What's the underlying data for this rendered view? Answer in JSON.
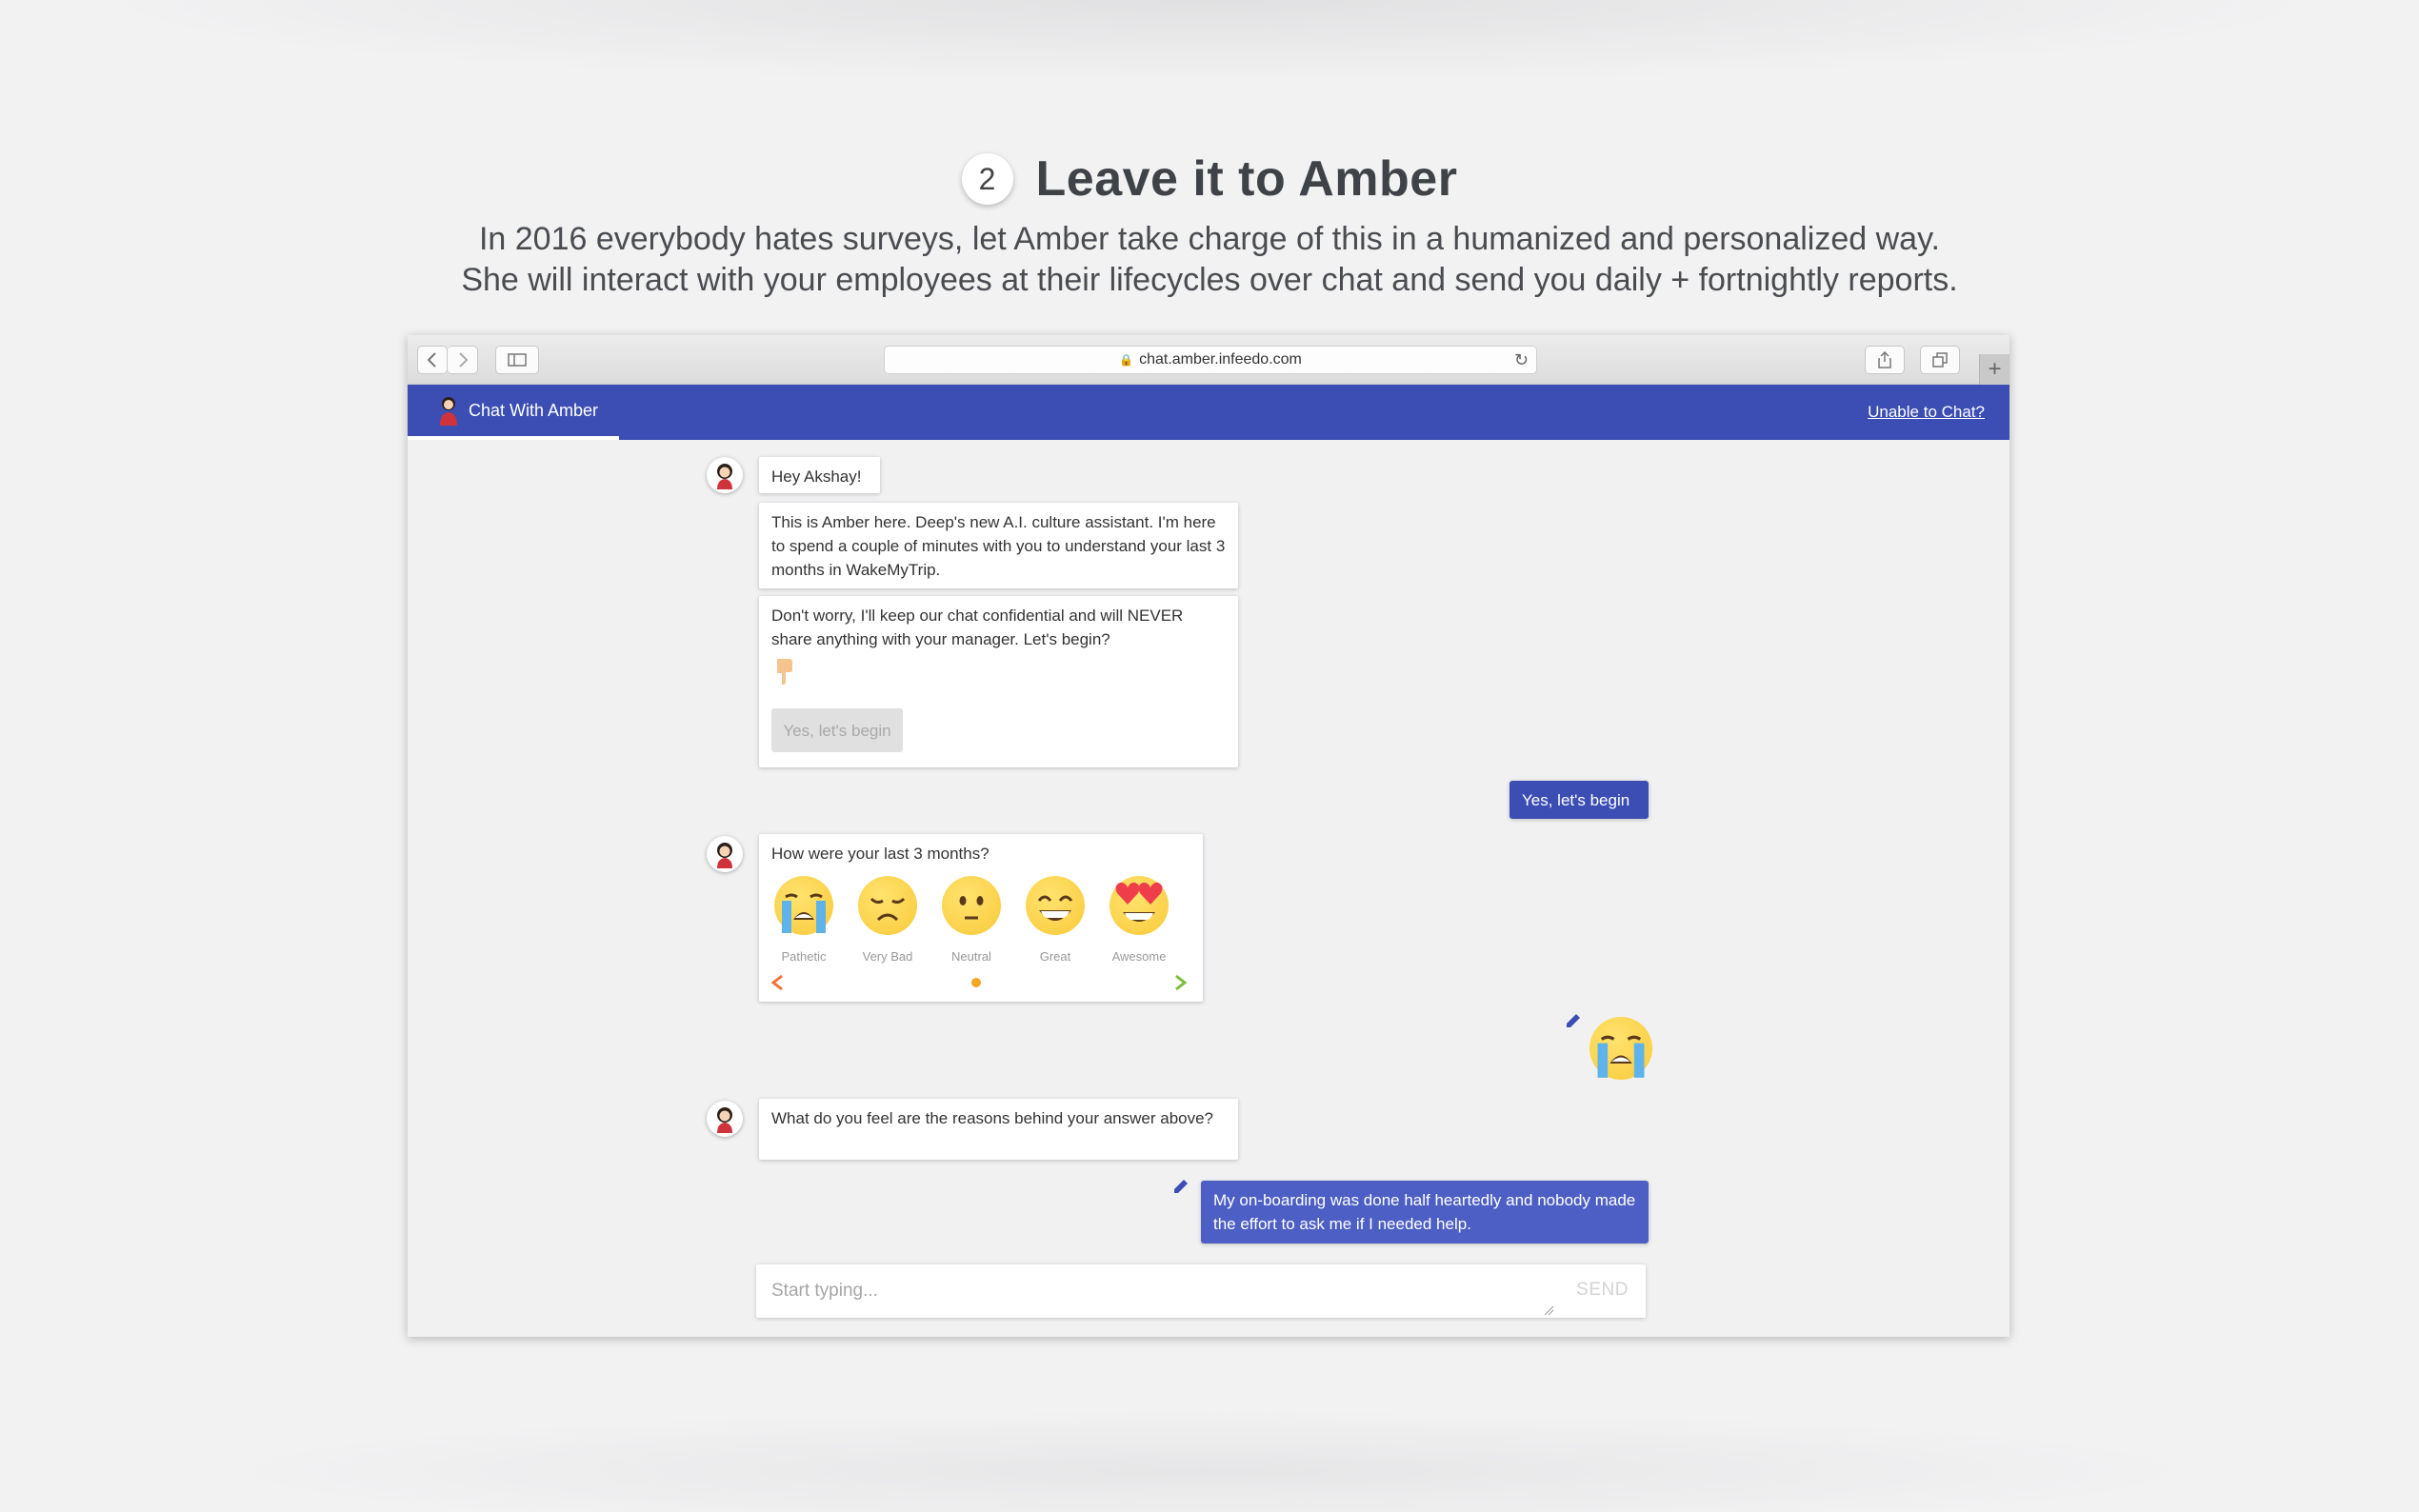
{
  "heading": {
    "step_number": "2",
    "title": "Leave it to Amber",
    "subtitle_line1": "In 2016 everybody hates surveys, let Amber take charge of this in a humanized and personalized way.",
    "subtitle_line2": "She will interact with your employees at their lifecycles over chat and send you daily + fortnightly reports."
  },
  "browser": {
    "url": "chat.amber.infeedo.com"
  },
  "navbar": {
    "tab_label": "Chat With Amber",
    "help_link": "Unable to Chat?",
    "color": "#3c4eb4"
  },
  "chat": {
    "greeting": "Hey Akshay!",
    "intro": "This is Amber here. Deep's new A.I. culture assistant. I'm here to spend a couple of minutes with you to understand your last 3 months in WakeMyTrip.",
    "confidential": "Don't worry, I'll keep our chat confidential and will NEVER share anything with your manager. Let's begin?",
    "begin_button": "Yes, let's begin",
    "user_reply_1": "Yes, let's begin",
    "question_1": "How were your last 3 months?",
    "emoji_options": [
      {
        "label": "Pathetic",
        "icon": "crying-face-icon"
      },
      {
        "label": "Very Bad",
        "icon": "sad-face-icon"
      },
      {
        "label": "Neutral",
        "icon": "neutral-face-icon"
      },
      {
        "label": "Great",
        "icon": "grin-face-icon"
      },
      {
        "label": "Awesome",
        "icon": "heart-eyes-face-icon"
      }
    ],
    "selected_emoji": "crying-face-icon",
    "question_2": "What do you feel are the reasons behind your answer above?",
    "user_reply_2": "My on-boarding was done half heartedly and nobody made the effort to ask me if I needed help."
  },
  "input": {
    "placeholder": "Start typing...",
    "send_label": "SEND"
  }
}
